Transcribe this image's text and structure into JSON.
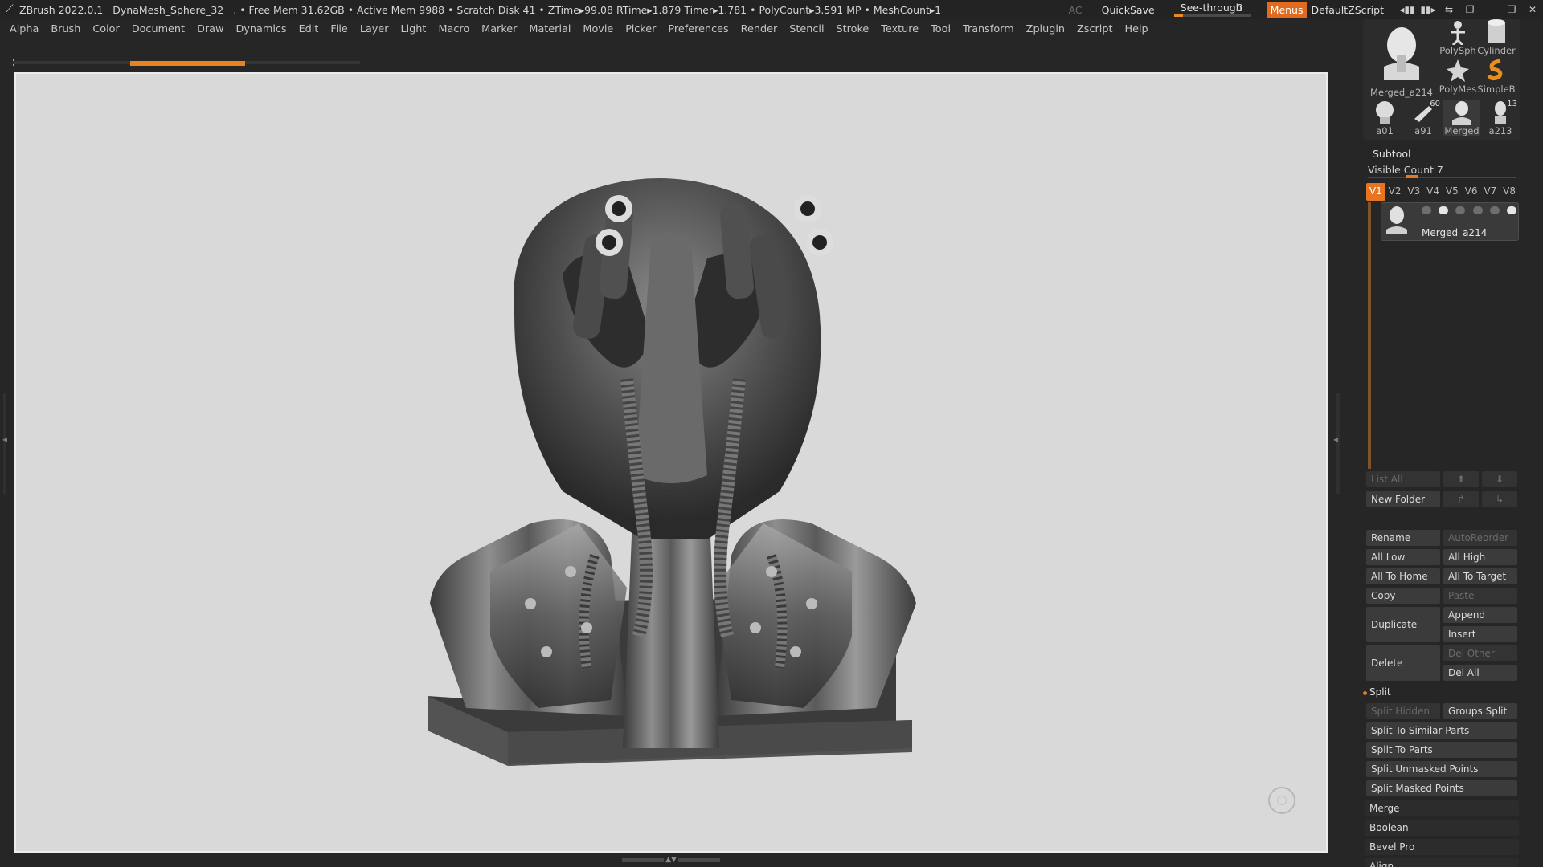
{
  "titlebar": {
    "app": "ZBrush 2022.0.1",
    "doc": "DynaMesh_Sphere_32",
    "stats": ". • Free Mem 31.62GB • Active Mem 9988 • Scratch Disk 41 • ZTime▸99.08 RTime▸1.879 Timer▸1.781 • PolyCount▸3.591 MP • MeshCount▸1",
    "ac": "AC",
    "quicksave": "QuickSave",
    "see_through_label": "See-through",
    "see_through_value": "0",
    "see_through_level": 0.12,
    "menus": "Menus",
    "script": "DefaultZScript",
    "accent": "#e06b1f"
  },
  "menubar": [
    "Alpha",
    "Brush",
    "Color",
    "Document",
    "Draw",
    "Dynamics",
    "Edit",
    "File",
    "Layer",
    "Light",
    "Macro",
    "Marker",
    "Material",
    "Movie",
    "Picker",
    "Preferences",
    "Render",
    "Stencil",
    "Stroke",
    "Texture",
    "Tool",
    "Transform",
    "Zplugin",
    "Zscript",
    "Help"
  ],
  "tools": {
    "main_label": "Merged_a214",
    "polysphere": "PolySph",
    "cylinder": "Cylinder",
    "polymesh": "PolyMes",
    "simplebrush": "SimpleB",
    "row3": [
      {
        "label": "a01",
        "badge": ""
      },
      {
        "label": "a91",
        "badge": "60"
      },
      {
        "label": "Merged",
        "badge": ""
      },
      {
        "label": "a213",
        "badge": "13"
      }
    ]
  },
  "subtool": {
    "title": "Subtool",
    "visible_count": "Visible Count 7",
    "vtabs": [
      "V1",
      "V2",
      "V3",
      "V4",
      "V5",
      "V6",
      "V7",
      "V8"
    ],
    "active_vtab": "V1",
    "item_name": "Merged_a214",
    "list_all": "List All",
    "new_folder": "New Folder",
    "rename": "Rename",
    "autoreorder": "AutoReorder",
    "all_low": "All Low",
    "all_high": "All High",
    "all_to_home": "All To Home",
    "all_to_target": "All To Target",
    "copy": "Copy",
    "paste": "Paste",
    "duplicate": "Duplicate",
    "append": "Append",
    "insert": "Insert",
    "delete": "Delete",
    "del_other": "Del Other",
    "del_all": "Del All",
    "split": "Split",
    "split_hidden": "Split Hidden",
    "groups_split": "Groups Split",
    "split_similar": "Split To Similar Parts",
    "split_parts": "Split To Parts",
    "split_unmasked": "Split Unmasked Points",
    "split_masked": "Split Masked Points",
    "merge": "Merge",
    "boolean": "Boolean",
    "bevel_pro": "Bevel Pro",
    "align": "Align"
  }
}
